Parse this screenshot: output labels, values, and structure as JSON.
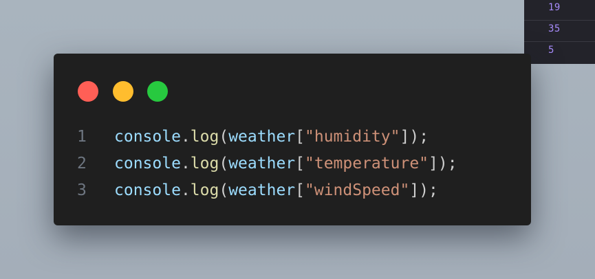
{
  "output_panel": {
    "values": [
      "19",
      "35",
      "5"
    ]
  },
  "window_controls": {
    "close_color": "#ff5f56",
    "minimize_color": "#ffbd2e",
    "maximize_color": "#27c93f"
  },
  "code": {
    "lines": [
      {
        "number": "1",
        "object": "console",
        "dot": ".",
        "method": "log",
        "open": "(",
        "arg": "weather",
        "bracket_open": "[",
        "key": "\"humidity\"",
        "bracket_close": "]",
        "close": ");"
      },
      {
        "number": "2",
        "object": "console",
        "dot": ".",
        "method": "log",
        "open": "(",
        "arg": "weather",
        "bracket_open": "[",
        "key": "\"temperature\"",
        "bracket_close": "]",
        "close": ");"
      },
      {
        "number": "3",
        "object": "console",
        "dot": ".",
        "method": "log",
        "open": "(",
        "arg": "weather",
        "bracket_open": "[",
        "key": "\"windSpeed\"",
        "bracket_close": "]",
        "close": ");"
      }
    ]
  },
  "colors": {
    "identifier": "#9cdcfe",
    "function": "#dcdcaa",
    "string": "#ce9178",
    "punctuation": "#cfcfcf",
    "line_number": "#6e7681",
    "output_value": "#a78bfa"
  }
}
